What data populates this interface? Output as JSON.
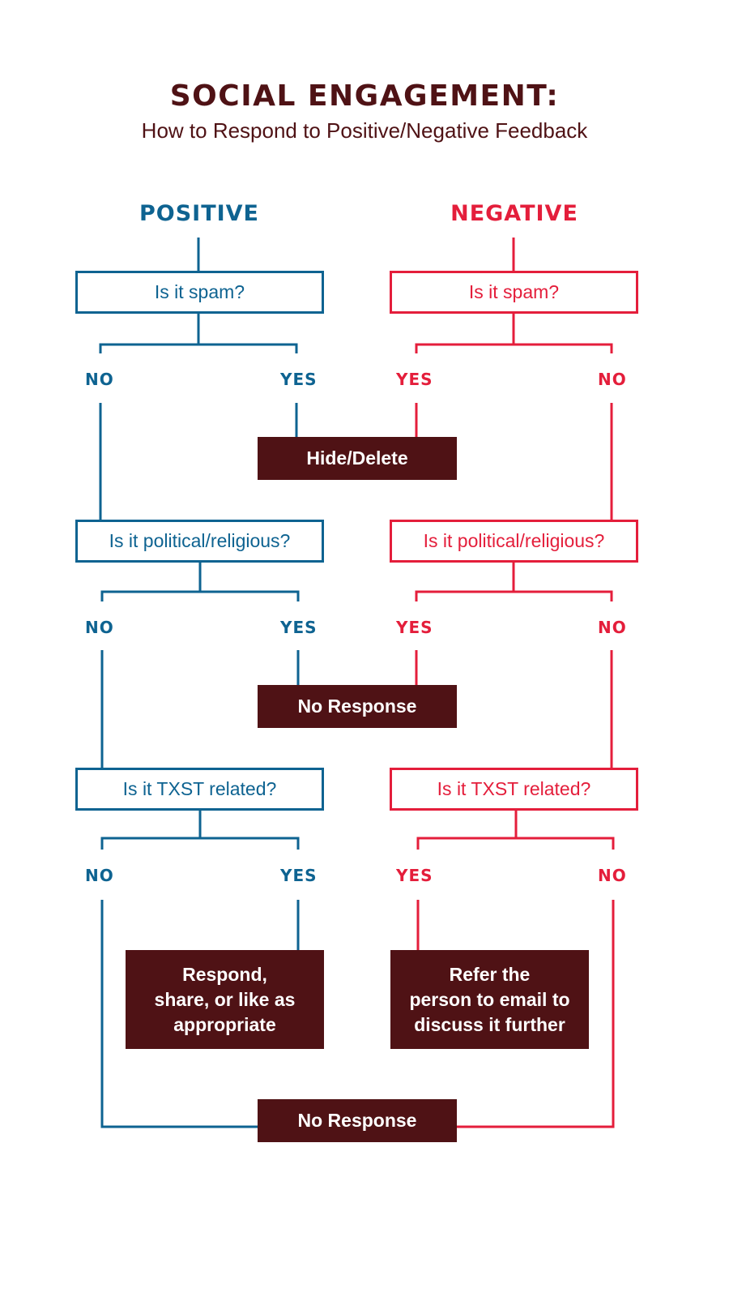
{
  "header": {
    "title": "SOCIAL ENGAGEMENT:",
    "subtitle": "How to Respond to Positive/Negative Feedback"
  },
  "colors": {
    "positive": "#0e6391",
    "negative": "#e41e3b",
    "action": "#4f1215",
    "title": "#4f1215"
  },
  "positive": {
    "heading": "POSITIVE",
    "questions": [
      "Is it spam?",
      "Is it political/religious?",
      "Is it TXST related?"
    ],
    "branches": [
      {
        "left": "NO",
        "right": "YES"
      },
      {
        "left": "NO",
        "right": "YES"
      },
      {
        "left": "NO",
        "right": "YES"
      }
    ]
  },
  "negative": {
    "heading": "NEGATIVE",
    "questions": [
      "Is it spam?",
      "Is it political/religious?",
      "Is it TXST related?"
    ],
    "branches": [
      {
        "left": "YES",
        "right": "NO"
      },
      {
        "left": "YES",
        "right": "NO"
      },
      {
        "left": "YES",
        "right": "NO"
      }
    ]
  },
  "actions": {
    "hide_delete": "Hide/Delete",
    "no_response_1": "No Response",
    "respond_share": [
      "Respond,",
      "share, or like as",
      "appropriate"
    ],
    "refer_email": [
      "Refer the",
      "person to email to",
      "discuss it further"
    ],
    "no_response_2": "No Response"
  }
}
